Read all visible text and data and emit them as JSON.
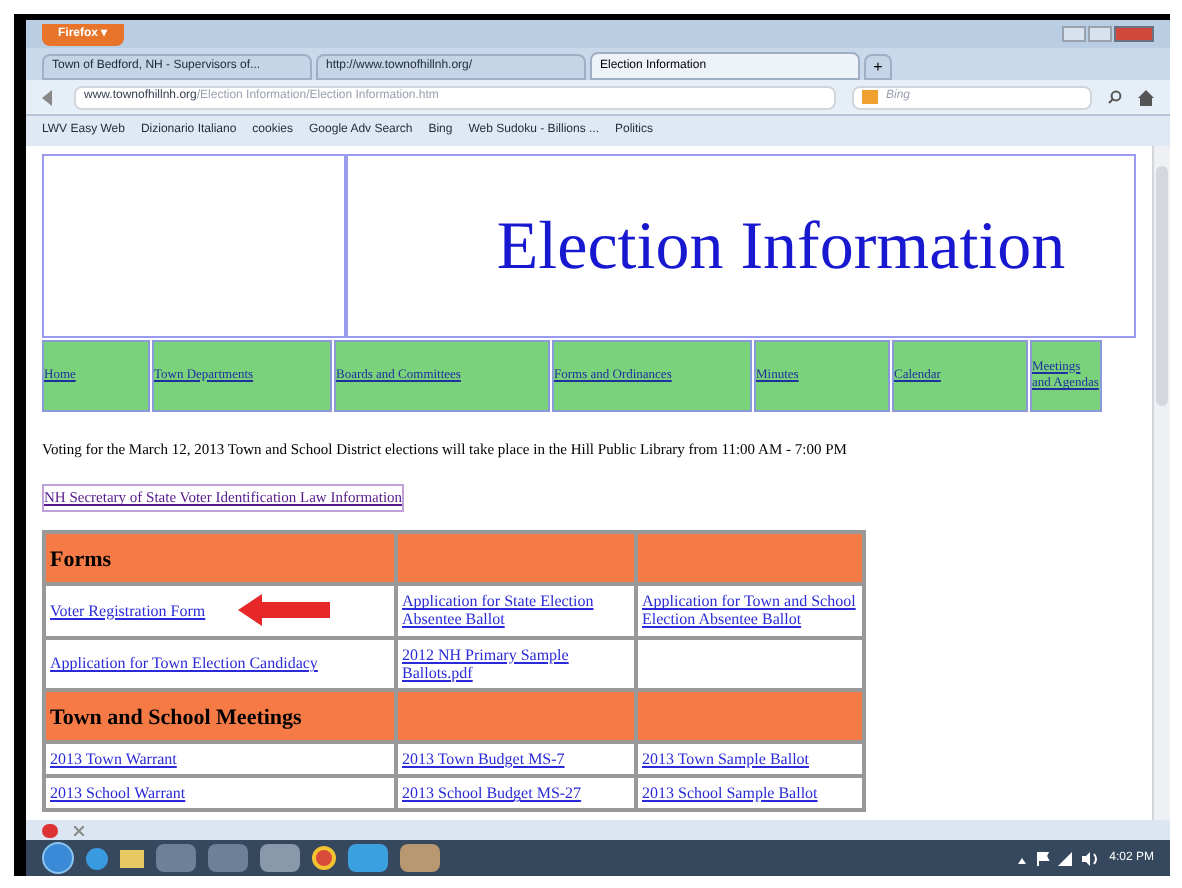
{
  "browser": {
    "menu_button": "Firefox ▾",
    "tabs": [
      {
        "label": "Town of Bedford, NH - Supervisors of...",
        "selected": false
      },
      {
        "label": "http://www.townofhillnh.org/",
        "selected": false
      },
      {
        "label": "Election Information",
        "selected": true
      }
    ],
    "new_tab": "+",
    "url_host": "www.townofhillnh.org",
    "url_path": "/Election Information/Election Information.htm",
    "search_placeholder": "Bing",
    "bookmarks": [
      "LWV Easy Web",
      "Dizionario Italiano",
      "cookies",
      "Google Adv Search",
      "Bing",
      "Web Sudoku - Billions ...",
      "Politics"
    ]
  },
  "page": {
    "title": "Election Information",
    "nav": [
      "Home",
      "Town Departments",
      "Boards and Committees",
      "Forms and Ordinances",
      "Minutes",
      "Calendar",
      "Meetings and Agendas"
    ],
    "notice": "Voting for the March 12, 2013 Town and School District elections will take place in the Hill Public Library from 11:00 AM - 7:00 PM",
    "id_link": "NH Secretary of State Voter Identification Law Information",
    "sections": [
      {
        "heading": "Forms",
        "rows": [
          [
            "Voter Registration Form",
            "Application for State Election Absentee Ballot",
            "Application for Town and School Election Absentee Ballot"
          ],
          [
            "Application for Town Election Candidacy",
            "2012 NH Primary Sample Ballots.pdf",
            ""
          ]
        ]
      },
      {
        "heading": "Town and School Meetings",
        "rows": [
          [
            "2013 Town Warrant",
            "2013 Town Budget MS-7",
            "2013 Town Sample Ballot"
          ],
          [
            "2013 School Warrant",
            "2013 School Budget MS-27",
            "2013 School Sample Ballot"
          ]
        ]
      }
    ]
  },
  "taskbar": {
    "clock": "4:02 PM"
  }
}
